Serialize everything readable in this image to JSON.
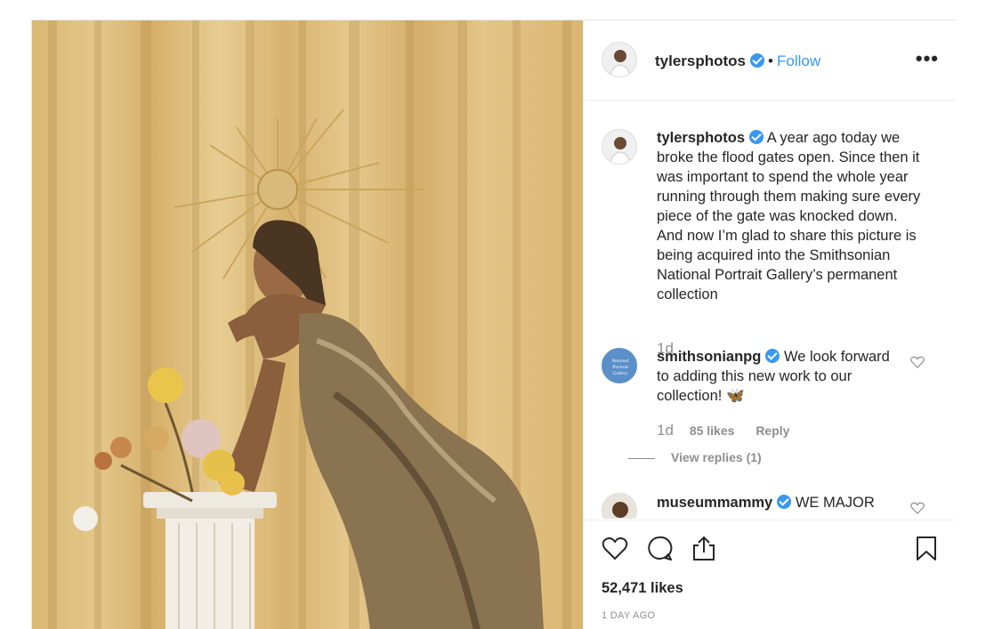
{
  "post": {
    "photo_alt": "Portrait photo",
    "author": {
      "username": "tylersphotos",
      "verified_icon": "verified-badge-icon",
      "separator": "•",
      "follow_label": "Follow"
    },
    "more_label": "•••",
    "comments": [
      {
        "username": "tylersphotos",
        "text": "A year ago today we broke the flood gates open. Since then it was important to spend the whole year running through them making sure every piece of the gate was knocked down. And now I’m glad to share this picture is being acquired into the Smithsonian National Portrait Gallery’s permanent collection",
        "age": "1d"
      },
      {
        "username": "smithsonianpg",
        "avatar_text": "National Portrait Gallery",
        "text": "We look forward to adding this new work to our collection! 🦋",
        "age": "1d",
        "likes": "85 likes",
        "reply_label": "Reply",
        "view_replies": "View replies (1)"
      },
      {
        "username": "museummammy",
        "text": "WE MAJOR"
      }
    ],
    "likes_count": "52,471 likes",
    "time_ago": "1 DAY AGO",
    "colors": {
      "accent": "#3897f0",
      "muted": "#8e8e8e",
      "text": "#262626",
      "border": "#efefef"
    }
  }
}
